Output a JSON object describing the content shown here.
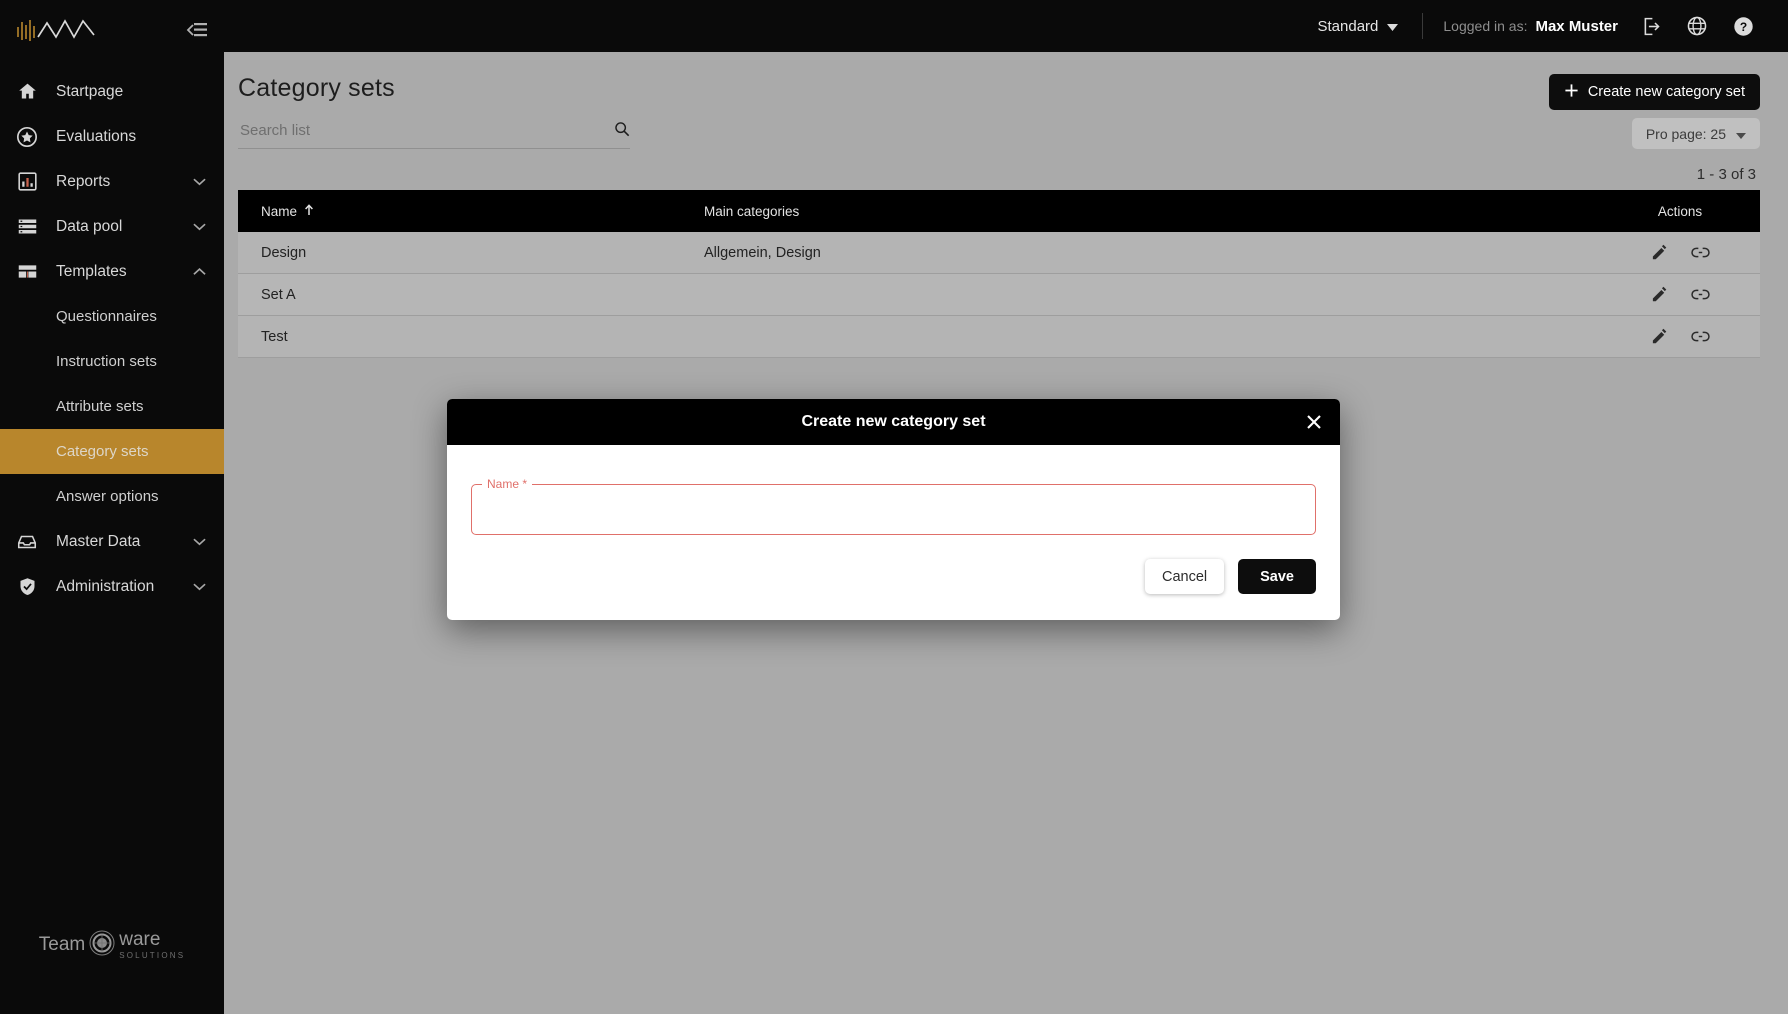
{
  "colors": {
    "sidebar_bg": "#0a0a0a",
    "accent_active": "#b8862c",
    "page_bg": "#aaaaaa",
    "table_header_bg": "#000000",
    "error_red": "#e0706a",
    "button_dark": "#0d0d0d"
  },
  "sidebar": {
    "brand": "logo-waveform-mountain",
    "collapse_icon": "collapse-menu-icon",
    "items": [
      {
        "label": "Startpage",
        "icon": "home-icon",
        "expandable": false,
        "expanded": null
      },
      {
        "label": "Evaluations",
        "icon": "star-badge-icon",
        "expandable": false,
        "expanded": null
      },
      {
        "label": "Reports",
        "icon": "bar-chart-icon",
        "expandable": true,
        "expanded": false
      },
      {
        "label": "Data pool",
        "icon": "list-rows-icon",
        "expandable": true,
        "expanded": false
      },
      {
        "label": "Templates",
        "icon": "layout-icon",
        "expandable": true,
        "expanded": true
      },
      {
        "label": "Master Data",
        "icon": "inbox-tray-icon",
        "expandable": true,
        "expanded": false
      },
      {
        "label": "Administration",
        "icon": "shield-check-icon",
        "expandable": true,
        "expanded": false
      }
    ],
    "templates_children": [
      {
        "label": "Questionnaires",
        "active": false
      },
      {
        "label": "Instruction sets",
        "active": false
      },
      {
        "label": "Attribute sets",
        "active": false
      },
      {
        "label": "Category sets",
        "active": true
      },
      {
        "label": "Answer options",
        "active": false
      }
    ],
    "footer_logo": {
      "text_left": "Team",
      "text_right": "ware",
      "subtitle": "SOLUTIONS"
    }
  },
  "topbar": {
    "mode_selector": "Standard",
    "logged_in_label": "Logged in as:",
    "user_name": "Max Muster",
    "icons": [
      "logout-icon",
      "globe-icon",
      "help-icon"
    ]
  },
  "page": {
    "title": "Category sets",
    "create_button": "Create new category set",
    "create_button_icon": "plus-icon",
    "search": {
      "placeholder": "Search list",
      "value": "",
      "icon": "search-icon"
    },
    "per_page": {
      "label": "Pro page: 25",
      "icon": "chevron-down-icon"
    },
    "result_count": "1 - 3 of 3"
  },
  "table": {
    "columns": [
      {
        "key": "name",
        "label": "Name",
        "sorted": true,
        "sort_icon": "arrow-up-icon"
      },
      {
        "key": "maincat",
        "label": "Main categories",
        "sorted": false,
        "sort_icon": null
      },
      {
        "key": "actions",
        "label": "Actions",
        "sorted": false,
        "sort_icon": null
      }
    ],
    "rows": [
      {
        "name": "Design",
        "maincat": "Allgemein, Design",
        "actions": [
          "edit-icon",
          "link-icon"
        ]
      },
      {
        "name": "Set A",
        "maincat": "",
        "actions": [
          "edit-icon",
          "link-icon"
        ]
      },
      {
        "name": "Test",
        "maincat": "",
        "actions": [
          "edit-icon",
          "link-icon"
        ]
      }
    ]
  },
  "modal": {
    "title": "Create new category set",
    "close_icon": "close-icon",
    "name_field": {
      "label": "Name *",
      "value": "",
      "placeholder": "",
      "invalid": true
    },
    "cancel_button": "Cancel",
    "save_button": "Save"
  }
}
